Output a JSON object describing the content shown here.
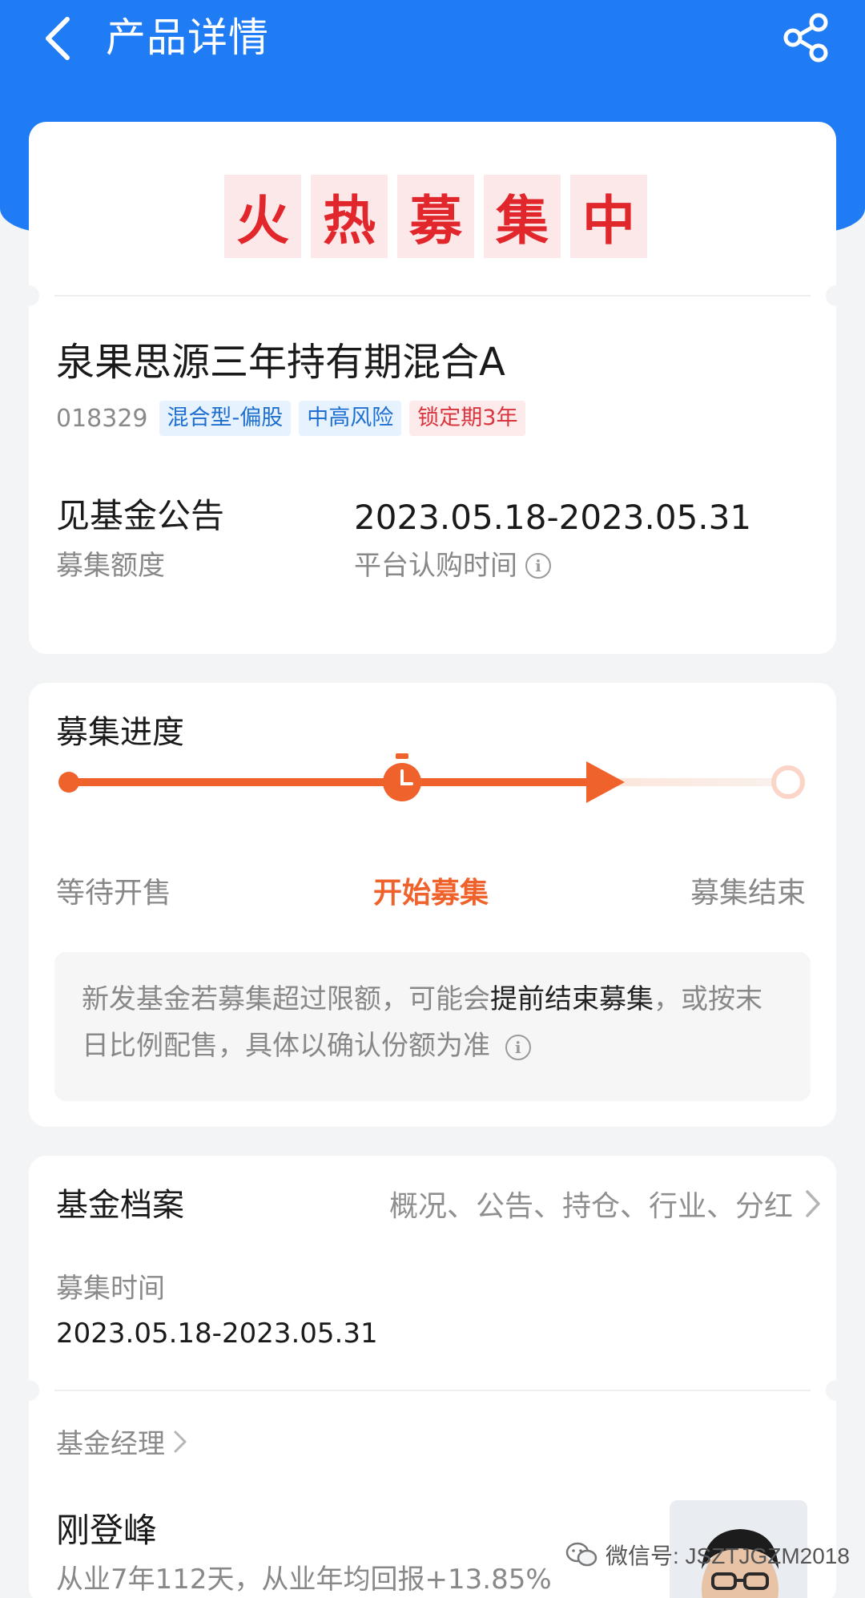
{
  "header": {
    "title": "产品详情"
  },
  "banner": {
    "chars": [
      "火",
      "热",
      "募",
      "集",
      "中"
    ]
  },
  "fund": {
    "name": "泉果思源三年持有期混合A",
    "code": "018329",
    "tags": [
      "混合型-偏股",
      "中高风险",
      "锁定期3年"
    ]
  },
  "stats": {
    "quota_value": "见基金公告",
    "quota_label": "募集额度",
    "period_value": "2023.05.18-2023.05.31",
    "period_label": "平台认购时间"
  },
  "progress": {
    "title": "募集进度",
    "steps": [
      "等待开售",
      "开始募集",
      "募集结束"
    ],
    "notice_pre": "新发基金若募集超过限额，可能会",
    "notice_bold": "提前结束募集",
    "notice_post": "，或按末日比例配售，具体以确认份额为准"
  },
  "archive": {
    "title": "基金档案",
    "links": "概况、公告、持仓、行业、分红",
    "time_label": "募集时间",
    "time_value": "2023.05.18-2023.05.31",
    "manager_link": "基金经理",
    "manager_name": "刚登峰",
    "manager_desc": "从业7年112天，从业年均回报+13.85%"
  },
  "watermark": {
    "text": "微信号: JSZTJGZM2018"
  },
  "colors": {
    "brand_blue": "#1f7cf5",
    "accent_orange": "#f0622c",
    "banner_red": "#e1262c"
  }
}
